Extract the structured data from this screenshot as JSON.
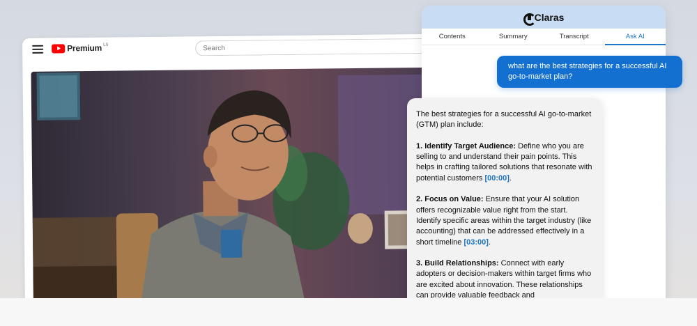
{
  "youtube": {
    "brand": "Premium",
    "region": "LS",
    "search_placeholder": "Search"
  },
  "claras": {
    "app_name": "Claras",
    "tabs": [
      {
        "label": "Contents",
        "active": false
      },
      {
        "label": "Summary",
        "active": false
      },
      {
        "label": "Transcript",
        "active": false
      },
      {
        "label": "Ask AI",
        "active": true
      }
    ],
    "user_message": "what are the best strategies for a successful AI go-to-market plan?",
    "answer": {
      "intro": "The best strategies for a successful AI go-to-market (GTM) plan include:",
      "points": [
        {
          "heading": "1. Identify Target Audience:",
          "text": "Define who you are selling to and understand their pain points. This helps in crafting tailored solutions that resonate with potential customers",
          "timestamp": "[00:00]"
        },
        {
          "heading": "2. Focus on Value:",
          "text": "Ensure that your AI solution offers recognizable value right from the start. Identify specific areas within the target industry (like accounting) that can be addressed effectively in a short timeline",
          "timestamp": "[03:00]"
        },
        {
          "heading": "3. Build Relationships:",
          "text": "Connect with early adopters or decision-makers within target firms who are excited about innovation. These relationships can provide valuable feedback and",
          "timestamp": ""
        }
      ]
    }
  },
  "colors": {
    "accent": "#1370d1",
    "header_bg": "#c8dcf3",
    "youtube_red": "#ff0000"
  }
}
